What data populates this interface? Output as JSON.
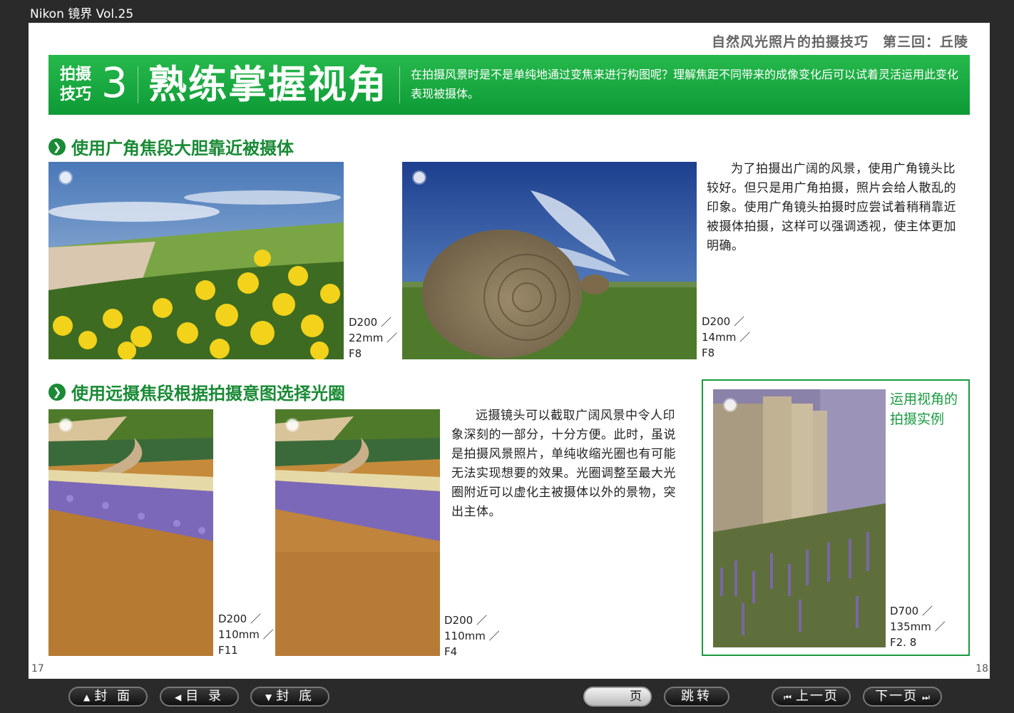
{
  "app": {
    "title": "Nikon 镜界 Vol.25"
  },
  "page": {
    "header": "自然风光照片的拍摄技巧　第三回：丘陵",
    "banner": {
      "label_line1": "拍摄",
      "label_line2": "技巧",
      "number": "3",
      "title": "熟练掌握视角",
      "description": "在拍摄风景时是不是单纯地通过变焦来进行构图呢？理解焦距不同带来的成像变化后可以试着灵活运用此变化表现被摄体。"
    },
    "section1": {
      "heading": "使用广角焦段大胆靠近被摄体",
      "text": "为了拍摄出广阔的风景，使用广角镜头比较好。但只是用广角拍摄，照片会给人散乱的印象。使用广角镜头拍摄时应尝试着稍稍靠近被摄体拍摄，这样可以强调透视，使主体更加明确。",
      "photo1": {
        "camera": "D200 ／",
        "focal": "22mm ／",
        "aperture": "F8"
      },
      "photo2": {
        "camera": "D200 ／",
        "focal": "14mm ／",
        "aperture": "F8"
      }
    },
    "section2": {
      "heading": "使用远摄焦段根据拍摄意图选择光圈",
      "text": "远摄镜头可以截取广阔风景中令人印象深刻的一部分，十分方便。此时，虽说是拍摄风景照片，单纯收缩光圈也有可能无法实现想要的效果。光圈调整至最大光圈附近可以虚化主被摄体以外的景物，突出主体。",
      "photo1": {
        "camera": "D200 ／",
        "focal": "110mm ／",
        "aperture": "F11"
      },
      "photo2": {
        "camera": "D200 ／",
        "focal": "110mm ／",
        "aperture": "F4"
      }
    },
    "example": {
      "title": "运用视角的拍摄实例",
      "exif": {
        "camera": "D700 ／",
        "focal": "135mm ／",
        "aperture": "F2. 8"
      }
    },
    "page_left": "17",
    "page_right": "18"
  },
  "nav": {
    "cover": "封 面",
    "toc": "目 录",
    "back_cover": "封 底",
    "page_input_value": "",
    "page_suffix": "页",
    "jump": "跳转",
    "prev": "上一页",
    "next": "下一页"
  },
  "icons": {
    "cover": "triangle-up-icon",
    "toc": "triangle-left-icon",
    "back_cover": "triangle-down-icon",
    "prev": "skip-back-icon",
    "next": "skip-forward-icon",
    "section": "chevron-right-icon"
  },
  "colors": {
    "brand_green": "#0e9a36",
    "heading_green": "#1a8a36"
  }
}
